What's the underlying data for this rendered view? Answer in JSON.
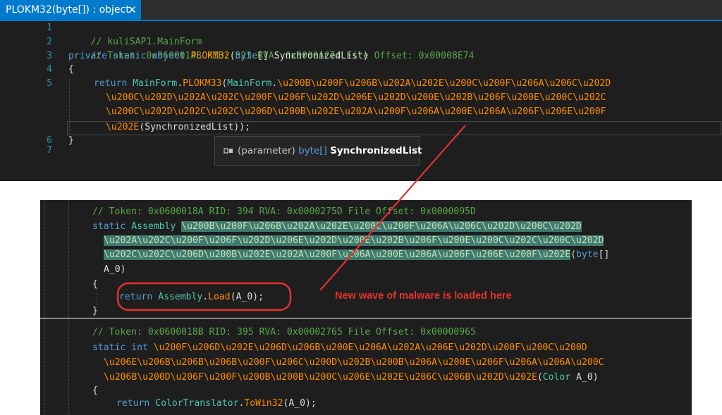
{
  "tab": {
    "title": "PLOKM32(byte[]) : object",
    "close": "✕"
  },
  "top_code": {
    "line_numbers": [
      "1",
      "2",
      "3",
      "4",
      "5",
      "6",
      "7"
    ],
    "l1": "// kuliSAP1.MainForm",
    "l2": "// Token: 0x06000143 RID: 323 RVA: 0x0000AC74 File Offset: 0x00008E74",
    "l3_kw": "private static object ",
    "l3_fn": "PLOKM32",
    "l3_open": "(",
    "l3_kw2": "byte",
    "l3_rest": "[] SynchronizedList)",
    "l4": "{",
    "l5_kw": "return ",
    "l5_ty": "MainForm",
    "l5_dot": ".",
    "l5_fn": "PLOKM33",
    "l5_open": "(",
    "l5_ty2": "MainForm",
    "l5_dot2": ".",
    "l5_seg1": "\\u200B\\u200F\\u206B\\u202A\\u202E\\u200C\\u200F\\u206A\\u206C\\u202D",
    "l5_seg2": "\\u200C\\u202D\\u202A\\u202C\\u200F\\u206F\\u202D\\u206E\\u202D\\u200E\\u202B\\u206F\\u200E\\u200C\\u202C",
    "l5_seg3": "\\u200C\\u202D\\u202C\\u202C\\u206D\\u200B\\u202E\\u202A\\u200F\\u206A\\u200E\\u206A\\u206F\\u206E\\u200F",
    "l5_seg4": "\\u202E",
    "l5_end": "(SynchronizedList));",
    "l6": "}"
  },
  "tooltip": {
    "kind": "(parameter)",
    "type": "byte",
    "rest": "[]",
    "name": "SynchronizedList"
  },
  "mid_code": {
    "c1": "// Token: 0x0600018A RID: 394 RVA: 0x0000275D File Offset: 0x0000095D",
    "c2_kw": "static ",
    "c2_ty": "Assembly ",
    "c2_hl1": "\\u200B\\u200F\\u206B\\u202A\\u202E\\u200C\\u200F\\u206A\\u206C\\u202D\\u200C\\u202D",
    "c3_hl": "\\u202A\\u202C\\u200F\\u206F\\u202D\\u206E\\u202D\\u200E\\u202B\\u206F\\u200E\\u200C\\u202C\\u200C\\u202D",
    "c4_hl": "\\u202C\\u202C\\u206D\\u200B\\u202E\\u202A\\u200F\\u206A\\u200E\\u206A\\u206F\\u206E\\u200F\\u202E",
    "c4_open": "(",
    "c4_kw": "byte",
    "c4_rest": "[]",
    "c5": "A_0)",
    "c6": "{",
    "c7_kw": "return ",
    "c7_ty": "Assembly",
    "c7_dot": ".",
    "c7_fn": "Load",
    "c7_rest": "(A_0);",
    "c8": "}"
  },
  "bot_code": {
    "c1": "// Token: 0x0600018B RID: 395 RVA: 0x00002765 File Offset: 0x00000965",
    "c2_kw": "static int ",
    "c2_fn": "\\u200F\\u206D\\u202E\\u206D\\u206B\\u200E\\u206A\\u202A\\u206E\\u202D\\u200F\\u200C\\u200D",
    "c3_fn": "\\u206E\\u206B\\u206B\\u206B\\u200F\\u206C\\u200D\\u202B\\u200B\\u206A\\u200E\\u206F\\u206A\\u206A\\u200C",
    "c4_fn": "\\u206B\\u200D\\u206F\\u200F\\u200B\\u200B\\u200C\\u206E\\u202E\\u206C\\u206B\\u202D\\u202E",
    "c4_open": "(",
    "c4_ty": "Color",
    "c4_rest": " A_0)",
    "c5": "{",
    "c6_kw": "return ",
    "c6_ty": "ColorTranslator",
    "c6_dot": ".",
    "c6_fn": "ToWin32",
    "c6_rest": "(A_0);"
  },
  "annotation": {
    "text": "New wave of malware is loaded here",
    "color": "#e2322d"
  },
  "colors": {
    "editor_bg": "#1e1e1e",
    "tab_bg": "#007acc",
    "comment": "#57a64a",
    "keyword": "#569cd6",
    "method": "#ff8c00",
    "type": "#4ec9b0",
    "line_number": "#2b91af",
    "highlight_bg": "#3e7a70"
  }
}
